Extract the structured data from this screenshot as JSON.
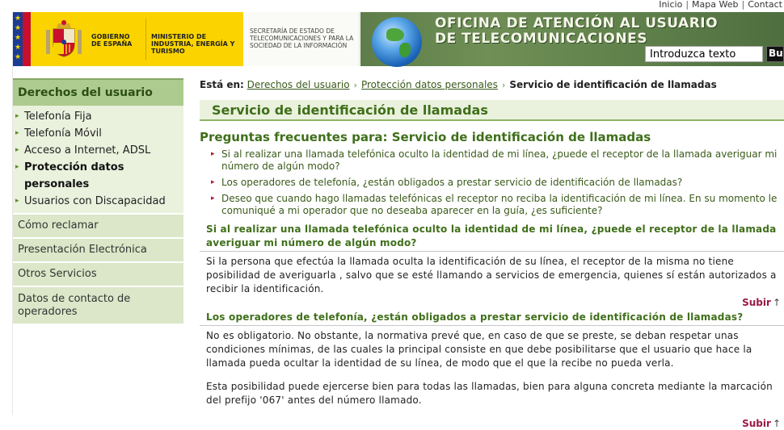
{
  "top_links": [
    "Inicio",
    "Mapa Web",
    "Contact"
  ],
  "header": {
    "gobierno": "GOBIERNO DE ESPAÑA",
    "ministerio": "MINISTERIO DE INDUSTRIA, ENERGÍA Y TURISMO",
    "secretaria": "SECRETARÍA DE ESTADO DE TELECOMUNICACIONES Y PARA LA SOCIEDAD DE LA INFORMACIÓN",
    "office_line1": "OFICINA DE ATENCIÓN AL USUARIO",
    "office_line2": "DE TELECOMUNICACIONES",
    "search_value": "Introduzca texto",
    "search_button": "Bu"
  },
  "sidebar": {
    "heading": "Derechos del usuario",
    "sub_items": [
      {
        "label": "Telefonía Fija",
        "active": false
      },
      {
        "label": "Telefonía Móvil",
        "active": false
      },
      {
        "label": "Acceso a Internet, ADSL",
        "active": false
      },
      {
        "label": "Protección datos personales",
        "active": true
      },
      {
        "label": "Usuarios con Discapacidad",
        "active": false
      }
    ],
    "sections": [
      "Cómo reclamar",
      "Presentación Electrónica",
      "Otros Servicios",
      "Datos de contacto de operadores"
    ]
  },
  "breadcrumb": {
    "label": "Está en:",
    "items": [
      "Derechos del usuario",
      "Protección datos personales"
    ],
    "current": "Servicio de identificación de llamadas"
  },
  "main": {
    "title": "Servicio de identificación de llamadas",
    "faq_heading": "Preguntas frecuentes para: Servicio de identificación de llamadas",
    "questions": [
      "Si al realizar una llamada telefónica oculto la identidad de mi línea, ¿puede el receptor de la llamada averiguar mi número de algún modo?",
      "Los operadores de telefonía, ¿están obligados a prestar servicio de identificación de llamadas?",
      "Deseo que cuando hago llamadas telefónicas el receptor no reciba la identificación de mi línea. En su momento le comuniqué a mi operador que no deseaba aparecer en la guía, ¿es suficiente?"
    ],
    "answers": [
      {
        "question": "Si al realizar una llamada telefónica oculto la identidad de mi línea, ¿puede el receptor de la llamada averiguar mi número de algún modo?",
        "paragraphs": [
          "Si la persona que efectúa la llamada oculta la identificación de su línea, el receptor de la misma no tiene posibilidad de averiguarla , salvo que se esté llamando a servicios de emergencia, quienes sí están autorizados a recibir la identificación."
        ]
      },
      {
        "question": "Los operadores de telefonía, ¿están obligados a prestar servicio de identificación de llamadas?",
        "paragraphs": [
          "No es obligatorio. No obstante, la normativa prevé que, en caso de que se preste, se deban respetar unas condiciones mínimas, de las cuales la principal consiste en que debe posibilitarse que el usuario que hace la llamada pueda ocultar la identidad de su línea, de modo que el que la recibe no pueda verla.",
          "Esta posibilidad puede ejercerse bien para todas las llamadas, bien para alguna concreta mediante la marcación del prefijo '067' antes del número llamado."
        ]
      }
    ],
    "subir_label": "Subir"
  },
  "colors": {
    "brand_yellow": "#fbd400",
    "header_green": "#6f8f56",
    "nav_green": "#aecb8f",
    "title_green": "#3f6f1a",
    "bullet_red": "#b3182b",
    "subir_color": "#9b1947"
  },
  "icons": [
    "coat-of-arms-icon",
    "eu-flag-icon",
    "globe-icon",
    "arrow-right-icon",
    "arrow-up-icon",
    "bullet-icon"
  ]
}
